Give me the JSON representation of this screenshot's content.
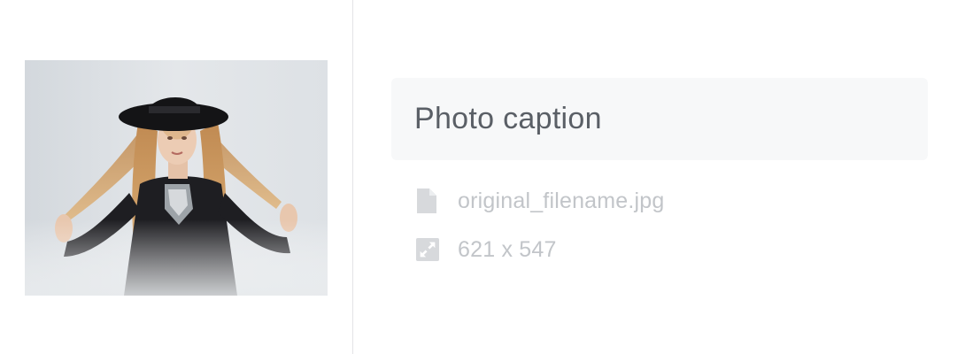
{
  "photo": {
    "alt": "Woman in black hat holding her long blonde hair"
  },
  "caption": {
    "placeholder": "Photo caption",
    "value": ""
  },
  "meta": {
    "filename": "original_filename.jpg",
    "dimensions": "621 x 547",
    "file_icon": "file-icon",
    "dimensions_icon": "expand-icon"
  },
  "colors": {
    "caption_bg": "#f7f8f9",
    "meta_text": "#c2c5c9",
    "icon": "#d7d9dc",
    "divider": "#e3e3e6"
  }
}
